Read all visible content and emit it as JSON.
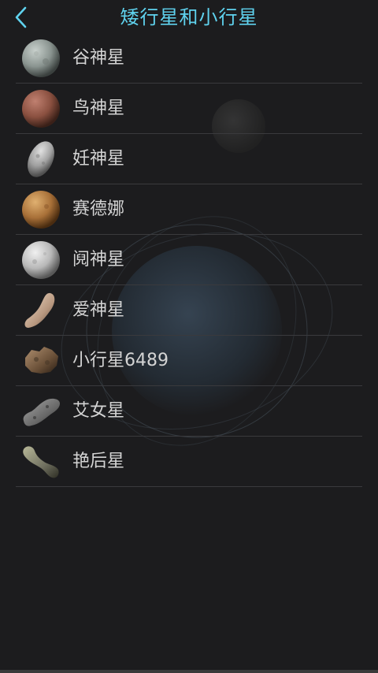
{
  "header": {
    "title": "矮行星和小行星",
    "back_icon": "chevron-left-icon",
    "accent_color": "#5fd2ee"
  },
  "list": {
    "items": [
      {
        "label": "谷神星",
        "icon": "ceres-thumbnail"
      },
      {
        "label": "鸟神星",
        "icon": "makemake-thumbnail"
      },
      {
        "label": "妊神星",
        "icon": "haumea-thumbnail"
      },
      {
        "label": "赛德娜",
        "icon": "sedna-thumbnail"
      },
      {
        "label": "阋神星",
        "icon": "eris-thumbnail"
      },
      {
        "label": "爱神星",
        "icon": "eros-thumbnail"
      },
      {
        "label": "小行星6489",
        "icon": "asteroid-6489-thumbnail"
      },
      {
        "label": "艾女星",
        "icon": "ida-thumbnail"
      },
      {
        "label": "艳后星",
        "icon": "kleopatra-thumbnail"
      }
    ]
  }
}
